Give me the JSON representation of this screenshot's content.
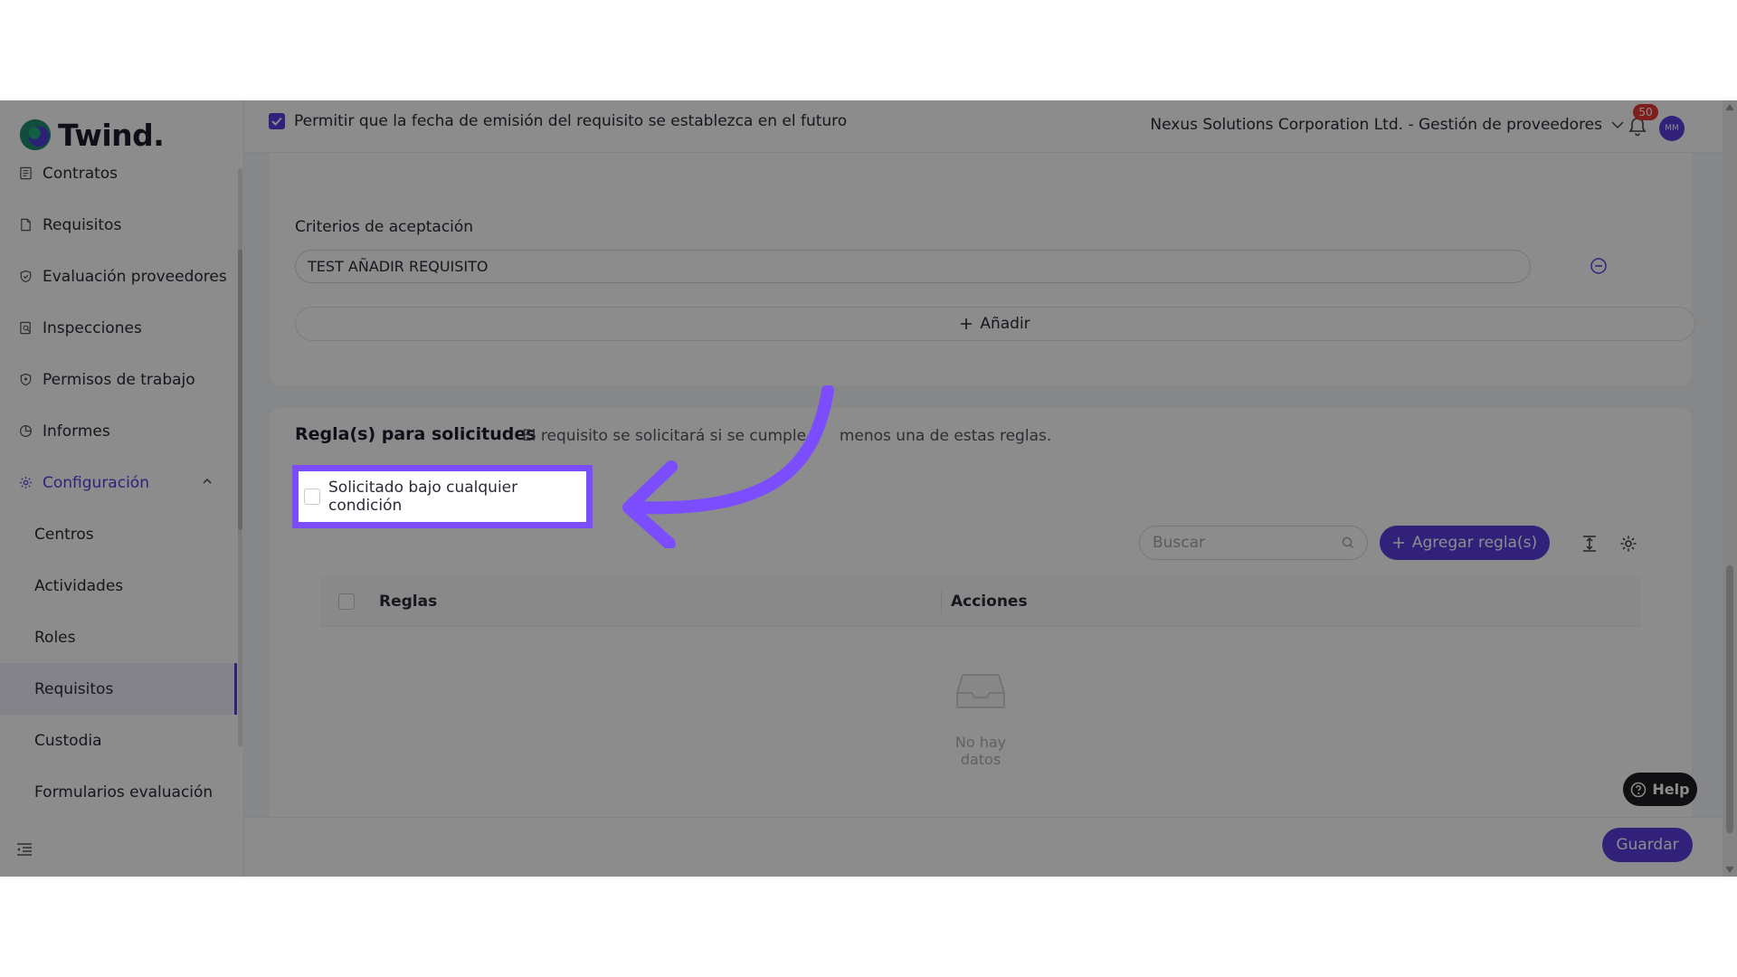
{
  "brand": {
    "name": "Twind."
  },
  "sidebar": {
    "items": [
      {
        "label": "Contratos",
        "icon": "contract-icon"
      },
      {
        "label": "Requisitos",
        "icon": "file-icon"
      },
      {
        "label": "Evaluación proveedores",
        "icon": "shield-check-icon"
      },
      {
        "label": "Inspecciones",
        "icon": "inspection-icon"
      },
      {
        "label": "Permisos de trabajo",
        "icon": "shield-icon"
      },
      {
        "label": "Informes",
        "icon": "pie-chart-icon"
      },
      {
        "label": "Configuración",
        "icon": "gear-icon"
      }
    ],
    "subitems": [
      {
        "label": "Centros"
      },
      {
        "label": "Actividades"
      },
      {
        "label": "Roles"
      },
      {
        "label": "Requisitos"
      },
      {
        "label": "Custodia"
      },
      {
        "label": "Formularios evaluación"
      }
    ]
  },
  "header": {
    "org": "Nexus Solutions Corporation Ltd. - Gestión de proveedores",
    "notifications": "50",
    "avatar": "MM"
  },
  "form": {
    "allow_future_label": "Permitir que la fecha de emisión del requisito se establezca en el futuro",
    "allow_future_checked": true,
    "criteria_label": "Criterios de aceptación",
    "criteria_value": "TEST AÑADIR REQUISITO",
    "add_label": "Añadir"
  },
  "rules": {
    "title": "Regla(s) para solicitudes",
    "description_part1": "El requisito se solicitará si se cumple",
    "description_part2": "menos una de estas reglas.",
    "condition_label": "Solicitado bajo cualquier condición",
    "search_placeholder": "Buscar",
    "add_rule_label": "Agregar regla(s)",
    "columns": [
      "Reglas",
      "Acciones"
    ],
    "empty_text": "No hay datos"
  },
  "footer": {
    "save_label": "Guardar"
  },
  "help": {
    "label": "Help"
  },
  "colors": {
    "accent": "#5b3de0",
    "highlight": "#7b4dff"
  }
}
